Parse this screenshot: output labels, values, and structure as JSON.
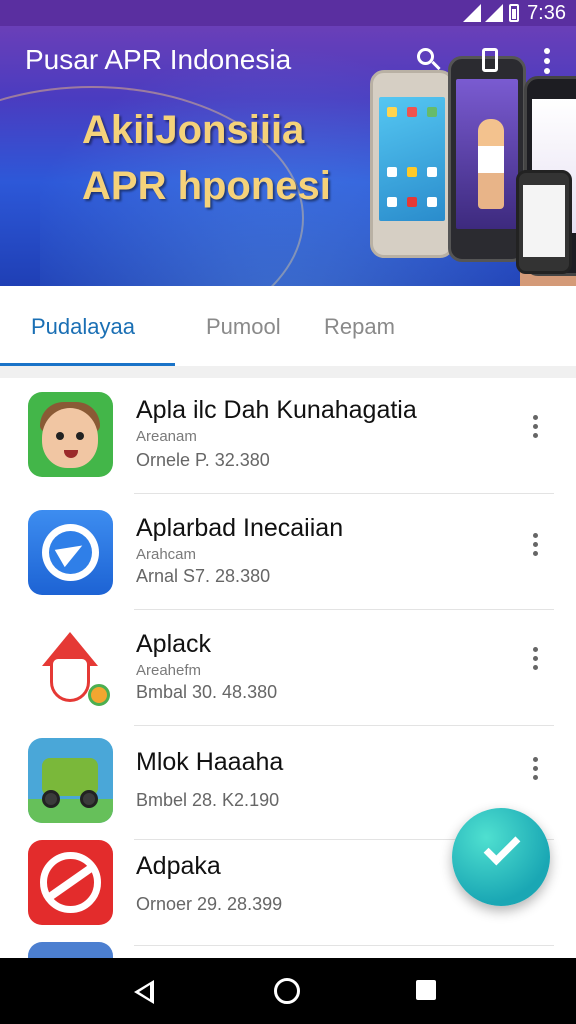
{
  "status_bar": {
    "time": "7:36"
  },
  "app_bar": {
    "title": "Pusar APR Indonesia",
    "icons": [
      "search-icon",
      "device-icon",
      "more-vert-icon"
    ]
  },
  "banner": {
    "line1": "AkiiJonsiiia",
    "line2": "APR hponesi"
  },
  "tabs": [
    {
      "label": "Pudalayaa",
      "active": true
    },
    {
      "label": "Pumool",
      "active": false
    },
    {
      "label": "Repam",
      "active": false
    }
  ],
  "apps": [
    {
      "name": "Apla ilc Dah Kunahagatia",
      "sub": "Areanam",
      "meta": "Ornele P. 32.380",
      "icon": "cartoon-face-icon"
    },
    {
      "name": "Aplarbad Inecaiian",
      "sub": "Arahcam",
      "meta": "Arnal S7. 28.380",
      "icon": "navigation-arrow-icon"
    },
    {
      "name": "Aplack",
      "sub": "Areahefm",
      "meta": "Bmbal 30. 48.380",
      "icon": "chicken-icon"
    },
    {
      "name": "Mlok Haaaha",
      "sub": "",
      "meta": "Bmbel 28. K2.190",
      "icon": "truck-game-icon"
    },
    {
      "name": "Adpaka",
      "sub": "",
      "meta": "Ornoer 29. 28.399",
      "icon": "prohibited-sign-icon"
    }
  ],
  "fab": {
    "icon": "checkmark-icon",
    "color": "#1aa7b4"
  },
  "colors": {
    "status_bar": "#5a2fa0",
    "active_tab": "#1a6fb4",
    "tab_indicator": "#1a73c8"
  },
  "nav_bar": {
    "icons": [
      "back-icon",
      "home-icon",
      "recents-icon"
    ]
  }
}
